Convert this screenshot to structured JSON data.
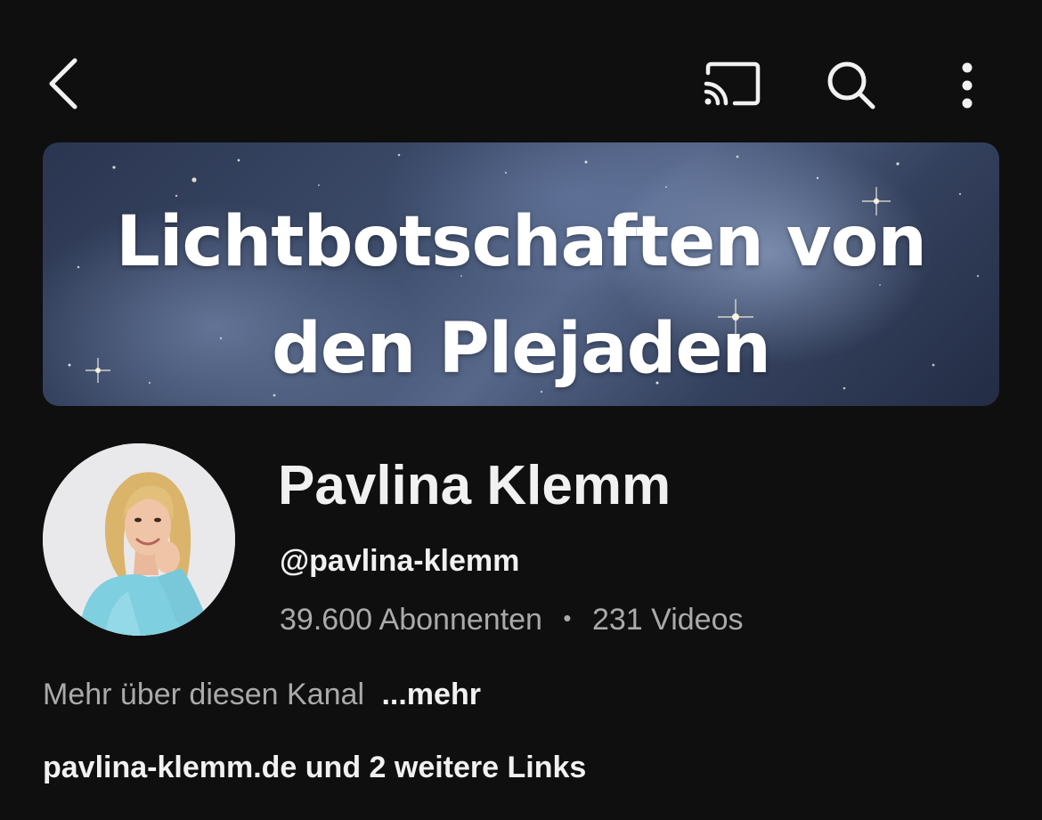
{
  "header": {
    "back_icon": "chevron-left-icon",
    "cast_icon": "cast-icon",
    "search_icon": "search-icon",
    "more_icon": "more-vertical-icon"
  },
  "banner": {
    "line1": "Lichtbotschaften von",
    "line2": "den Plejaden"
  },
  "channel": {
    "name": "Pavlina Klemm",
    "handle": "@pavlina-klemm",
    "subscribers": "39.600 Abonnenten",
    "separator": "•",
    "videos": "231 Videos"
  },
  "about": {
    "text": "Mehr über diesen Kanal",
    "more_label": "...mehr"
  },
  "links": {
    "text": "pavlina-klemm.de und 2 weitere Links"
  },
  "colors": {
    "background": "#0f0f0f",
    "primary_text": "#f1f1f1",
    "secondary_text": "#aaaaaa"
  }
}
